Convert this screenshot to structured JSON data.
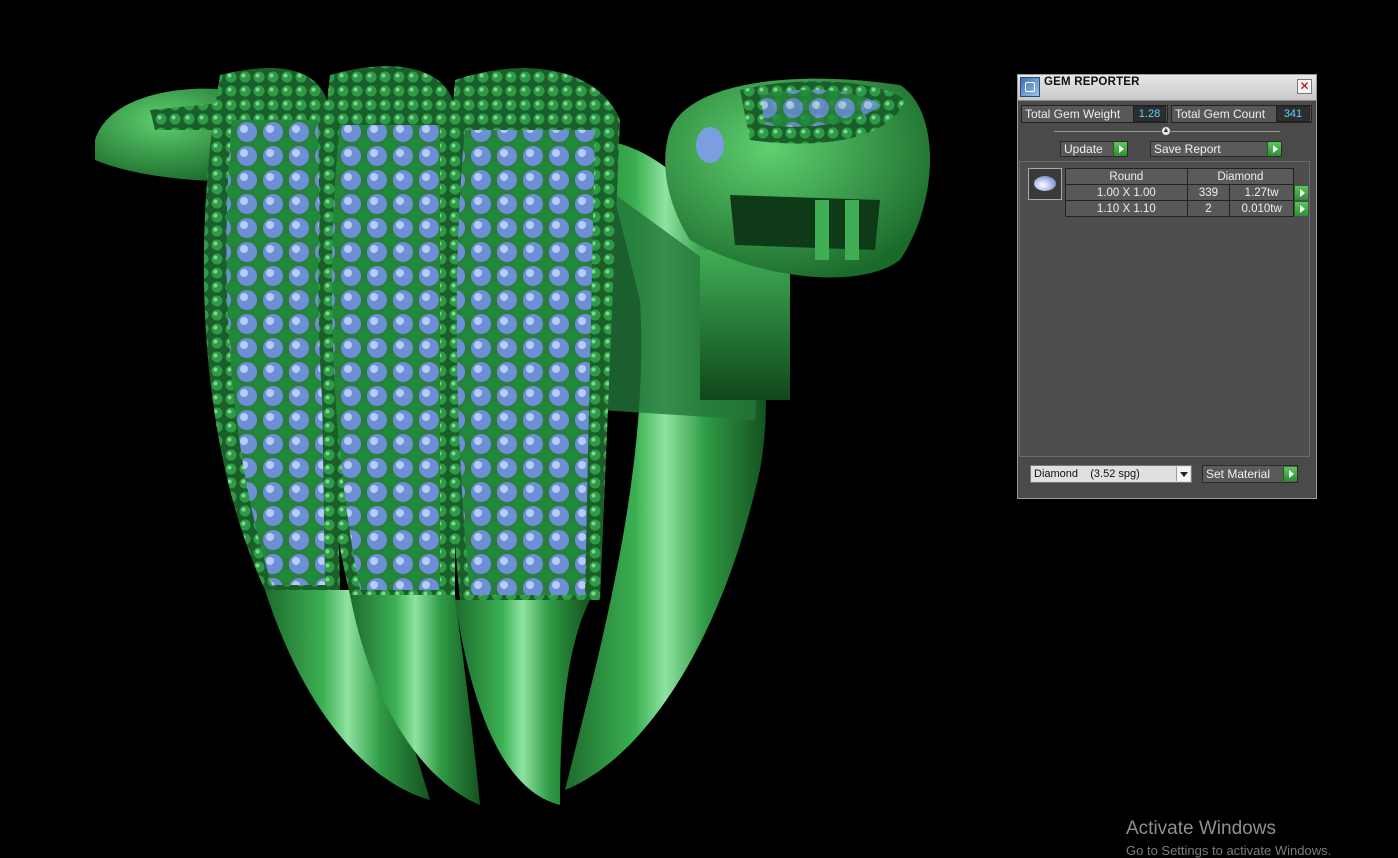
{
  "panel": {
    "title": "GEM REPORTER",
    "total_gem_weight_label": "Total Gem Weight",
    "total_gem_weight_value": "1.28",
    "total_gem_count_label": "Total Gem Count",
    "total_gem_count_value": "341",
    "update_button": "Update",
    "save_report_button": "Save Report",
    "table": {
      "headers": [
        "Round",
        "Diamond"
      ],
      "rows": [
        {
          "size": "1.00 X 1.00",
          "count": "339",
          "weight": "1.27tw"
        },
        {
          "size": "1.10 X 1.10",
          "count": "2",
          "weight": "0.010tw"
        }
      ]
    },
    "material_select": "Diamond    (3.52 spg)",
    "set_material_button": "Set Material"
  },
  "watermark": {
    "line1": "Activate Windows",
    "line2": "Go to Settings to activate Windows."
  },
  "colors": {
    "metal_green": "#2f9a44",
    "gem_blue": "#7a9ee0",
    "go_green": "#3fae43",
    "value_cyan": "#5ad6ff"
  }
}
